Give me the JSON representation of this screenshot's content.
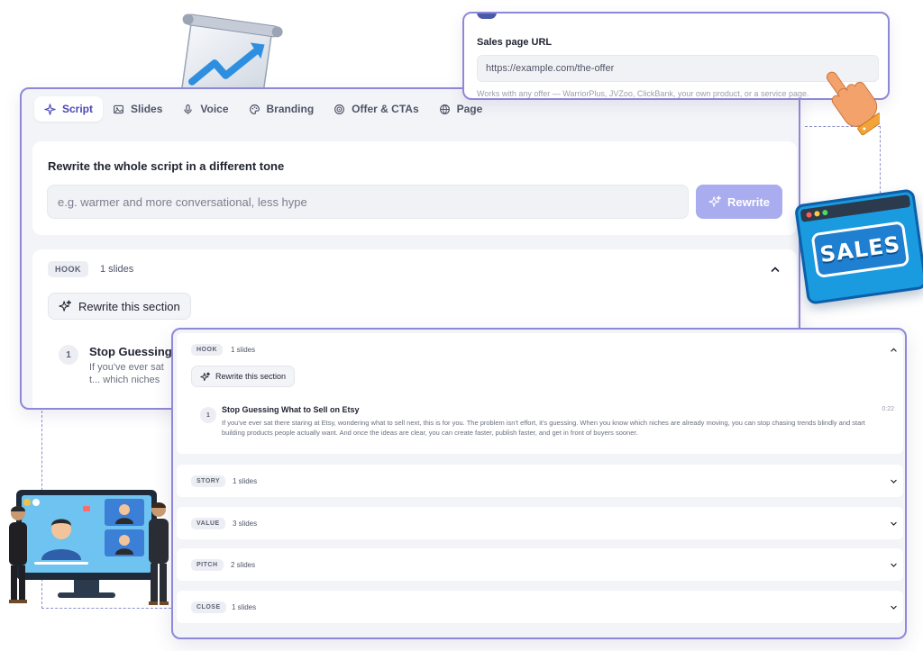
{
  "tabs": [
    {
      "label": "Script",
      "icon": "sparkle-icon",
      "active": true
    },
    {
      "label": "Slides",
      "icon": "image-icon",
      "active": false
    },
    {
      "label": "Voice",
      "icon": "microphone-icon",
      "active": false
    },
    {
      "label": "Branding",
      "icon": "palette-icon",
      "active": false
    },
    {
      "label": "Offer & CTAs",
      "icon": "target-icon",
      "active": false
    },
    {
      "label": "Page",
      "icon": "globe-icon",
      "active": false
    }
  ],
  "tone": {
    "title": "Rewrite the whole script in a different tone",
    "placeholder": "e.g. warmer and more conversational, less hype",
    "button_label": "Rewrite"
  },
  "hook_panel": {
    "tag": "HOOK",
    "count": "1 slides",
    "rewrite_label": "Rewrite this section",
    "slide_number": "1",
    "slide_title": "Stop Guessing",
    "slide_body": "If you've ever sat t... which niches are"
  },
  "sales_url": {
    "label": "Sales page URL",
    "value": "https://example.com/the-offer",
    "help": "Works with any offer — WarriorPlus, JVZoo, ClickBank, your own product, or a service page."
  },
  "sections": {
    "hook": {
      "tag": "HOOK",
      "count": "1 slides",
      "rewrite_label": "Rewrite this section",
      "slide_number": "1",
      "slide_title": "Stop Guessing What to Sell on Etsy",
      "slide_time": "0:22",
      "slide_body": "If you've ever sat there staring at Etsy, wondering what to sell next, this is for you. The problem isn't effort, it's guessing. When you know which niches are already moving, you can stop chasing trends blindly and start building products people actually want. And once the ideas are clear, you can create faster, publish faster, and get in front of buyers sooner."
    },
    "story": {
      "tag": "STORY",
      "count": "1 slides"
    },
    "value": {
      "tag": "VALUE",
      "count": "3 slides"
    },
    "pitch": {
      "tag": "PITCH",
      "count": "2 slides"
    },
    "close": {
      "tag": "CLOSE",
      "count": "1 slides"
    }
  },
  "decorations": {
    "badge_text": "SALES",
    "colors": {
      "accent": "#4b47b6",
      "card_border": "#8e88d8",
      "button_disabled": "#a9acee",
      "sales_blue": "#1a9be0"
    }
  }
}
